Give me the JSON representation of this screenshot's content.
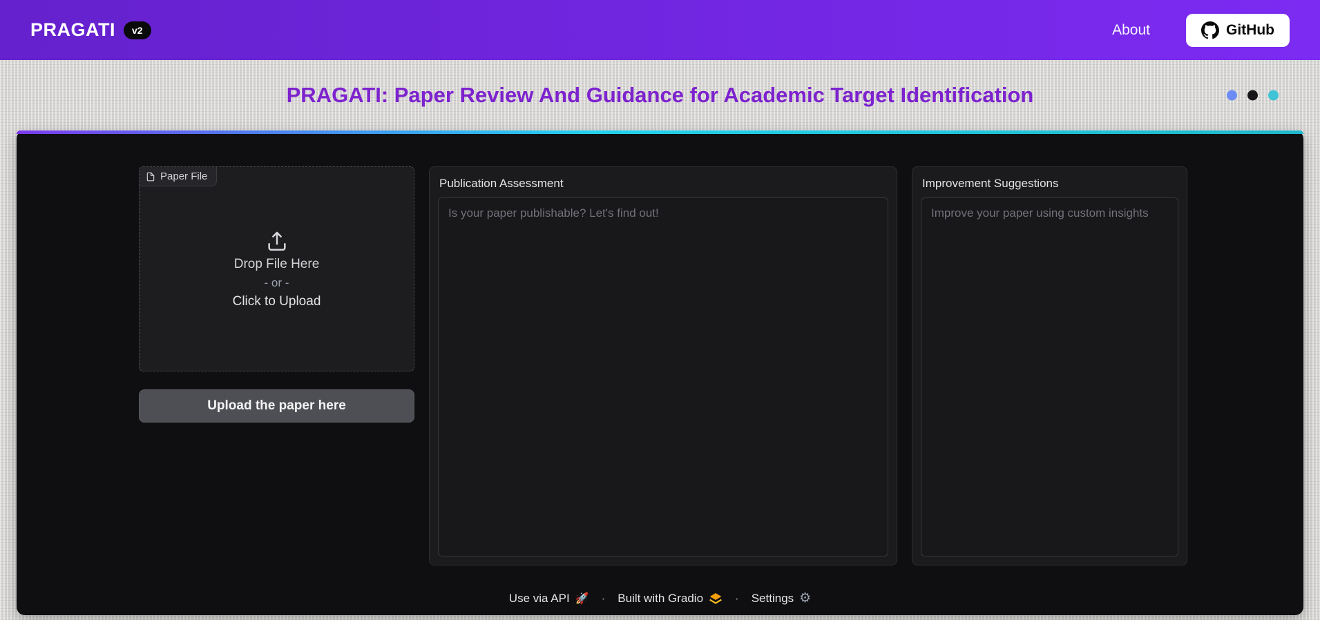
{
  "navbar": {
    "brand": "PRAGATI",
    "version_badge": "v2",
    "about_label": "About",
    "github_label": "GitHub"
  },
  "header": {
    "title": "PRAGATI: Paper Review And Guidance for Academic Target Identification"
  },
  "file_upload": {
    "label": "Paper File",
    "drop_text": "Drop File Here",
    "or_text": "- or -",
    "click_text": "Click to Upload",
    "button_label": "Upload the paper here"
  },
  "assessment": {
    "label": "Publication Assessment",
    "placeholder": "Is your paper publishable? Let's find out!"
  },
  "suggestions": {
    "label": "Improvement Suggestions",
    "placeholder": "Improve your paper using custom insights"
  },
  "footer": {
    "api_label": "Use via API",
    "gradio_label": "Built with Gradio",
    "settings_label": "Settings",
    "separator": "·"
  },
  "icons": {
    "rocket": "🚀",
    "gear": "⚙"
  },
  "colors": {
    "navbar_start": "#6521cd",
    "navbar_end": "#7c2bf2",
    "title": "#7d22ce",
    "accent_bar_start": "#7c3aed",
    "accent_bar_end": "#22d3ee",
    "dot_blue": "#6d8bf5",
    "dot_black": "#17171a",
    "dot_cyan": "#3fc3d6",
    "panel_bg": "#0f0f11"
  }
}
